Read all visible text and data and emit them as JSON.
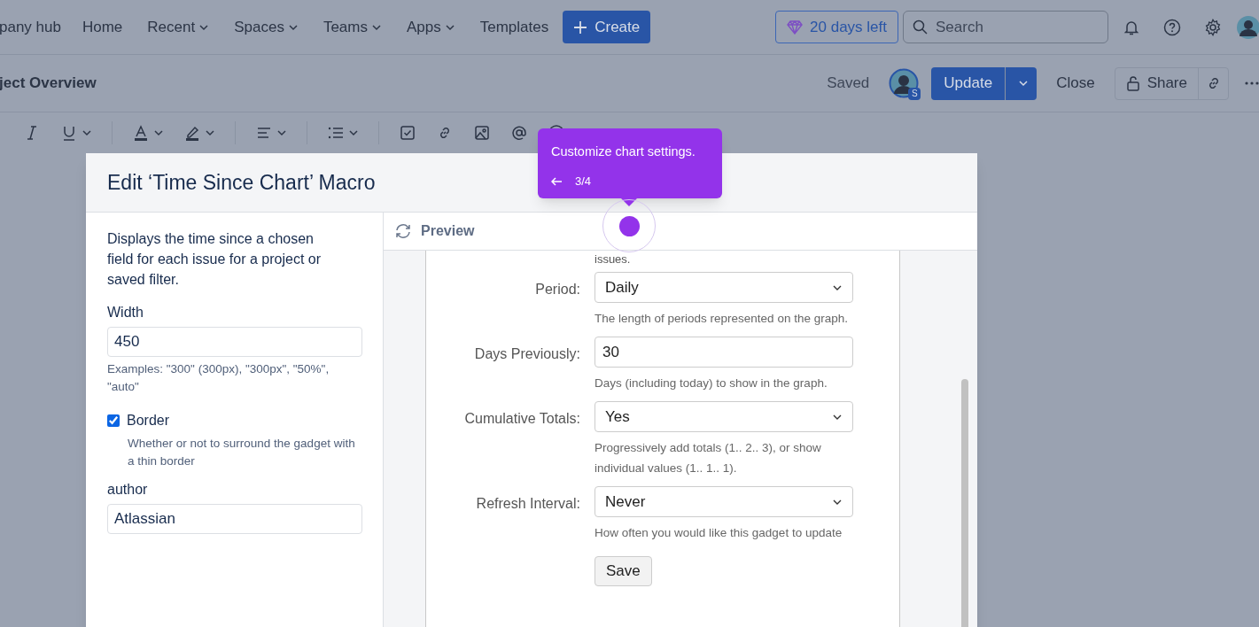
{
  "nav": {
    "items": [
      {
        "label": "pany hub",
        "dropdown": false
      },
      {
        "label": "Home",
        "dropdown": false
      },
      {
        "label": "Recent",
        "dropdown": true
      },
      {
        "label": "Spaces",
        "dropdown": true
      },
      {
        "label": "Teams",
        "dropdown": true
      },
      {
        "label": "Apps",
        "dropdown": true
      },
      {
        "label": "Templates",
        "dropdown": false
      }
    ],
    "create_button": "Create",
    "trial_badge": "20 days left",
    "search": {
      "placeholder": "Search"
    }
  },
  "page_bar": {
    "title": "ject Overview",
    "status": "Saved",
    "avatar_badge": "S",
    "update_button": "Update",
    "close_button": "Close",
    "share_button": "Share"
  },
  "modal": {
    "title": "Edit ‘Time Since Chart’ Macro",
    "description": "Displays the time since a chosen field for each issue for a project or saved filter.",
    "fields": [
      {
        "kind": "text",
        "label": "Width",
        "value": "450",
        "hint": "Examples: \"300\" (300px), \"300px\", \"50%\", \"auto\""
      },
      {
        "kind": "checkbox",
        "label": "Border",
        "checked": true,
        "hint": "Whether or not to surround the gadget with a thin border"
      },
      {
        "kind": "text",
        "label": "author",
        "value": "Atlassian"
      }
    ],
    "preview": {
      "title": "Preview",
      "cut_text": "issues.",
      "fields": [
        {
          "kind": "select",
          "label": "Period:",
          "value": "Daily",
          "hint": "The length of periods represented on the graph."
        },
        {
          "kind": "text",
          "label": "Days Previously:",
          "value": "30",
          "hint": "Days (including today) to show in the graph."
        },
        {
          "kind": "select",
          "label": "Cumulative Totals:",
          "value": "Yes",
          "hint": "Progressively add totals (1.. 2.. 3), or show individual values (1.. 1.. 1)."
        },
        {
          "kind": "select",
          "label": "Refresh Interval:",
          "value": "Never",
          "hint": "How often you would like this gadget to update"
        }
      ],
      "save_button": "Save"
    }
  },
  "tooltip": {
    "text": "Customize chart settings.",
    "step": "3/4"
  }
}
